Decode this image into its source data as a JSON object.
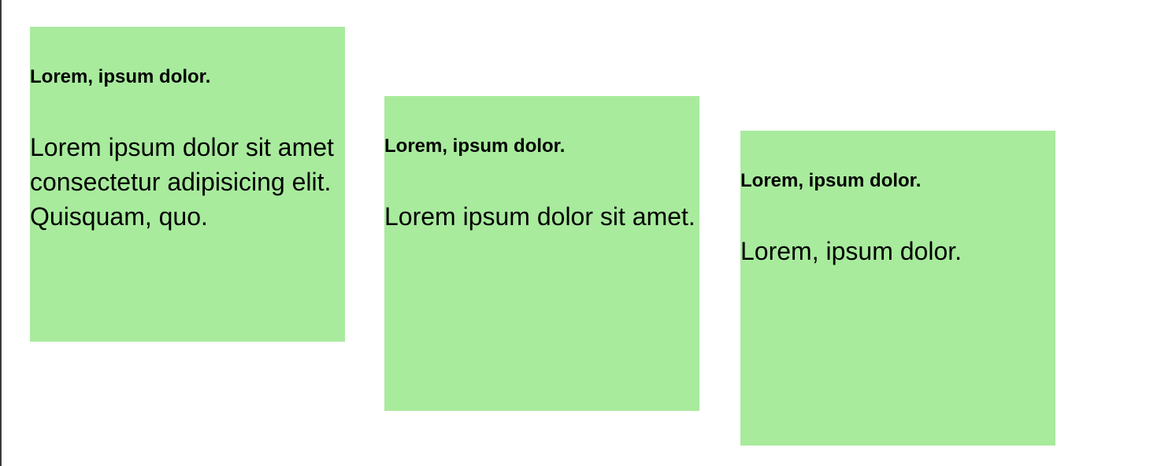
{
  "colors": {
    "card_background": "#a8eb9d",
    "page_background": "#ffffff",
    "left_border": "#3a3a3a"
  },
  "cards": [
    {
      "title": "Lorem, ipsum dolor.",
      "body": "Lorem ipsum dolor sit amet consectetur adipisicing elit. Quisquam, quo."
    },
    {
      "title": "Lorem, ipsum dolor.",
      "body": "Lorem ipsum dolor sit amet."
    },
    {
      "title": "Lorem, ipsum dolor.",
      "body": "Lorem, ipsum dolor."
    }
  ]
}
